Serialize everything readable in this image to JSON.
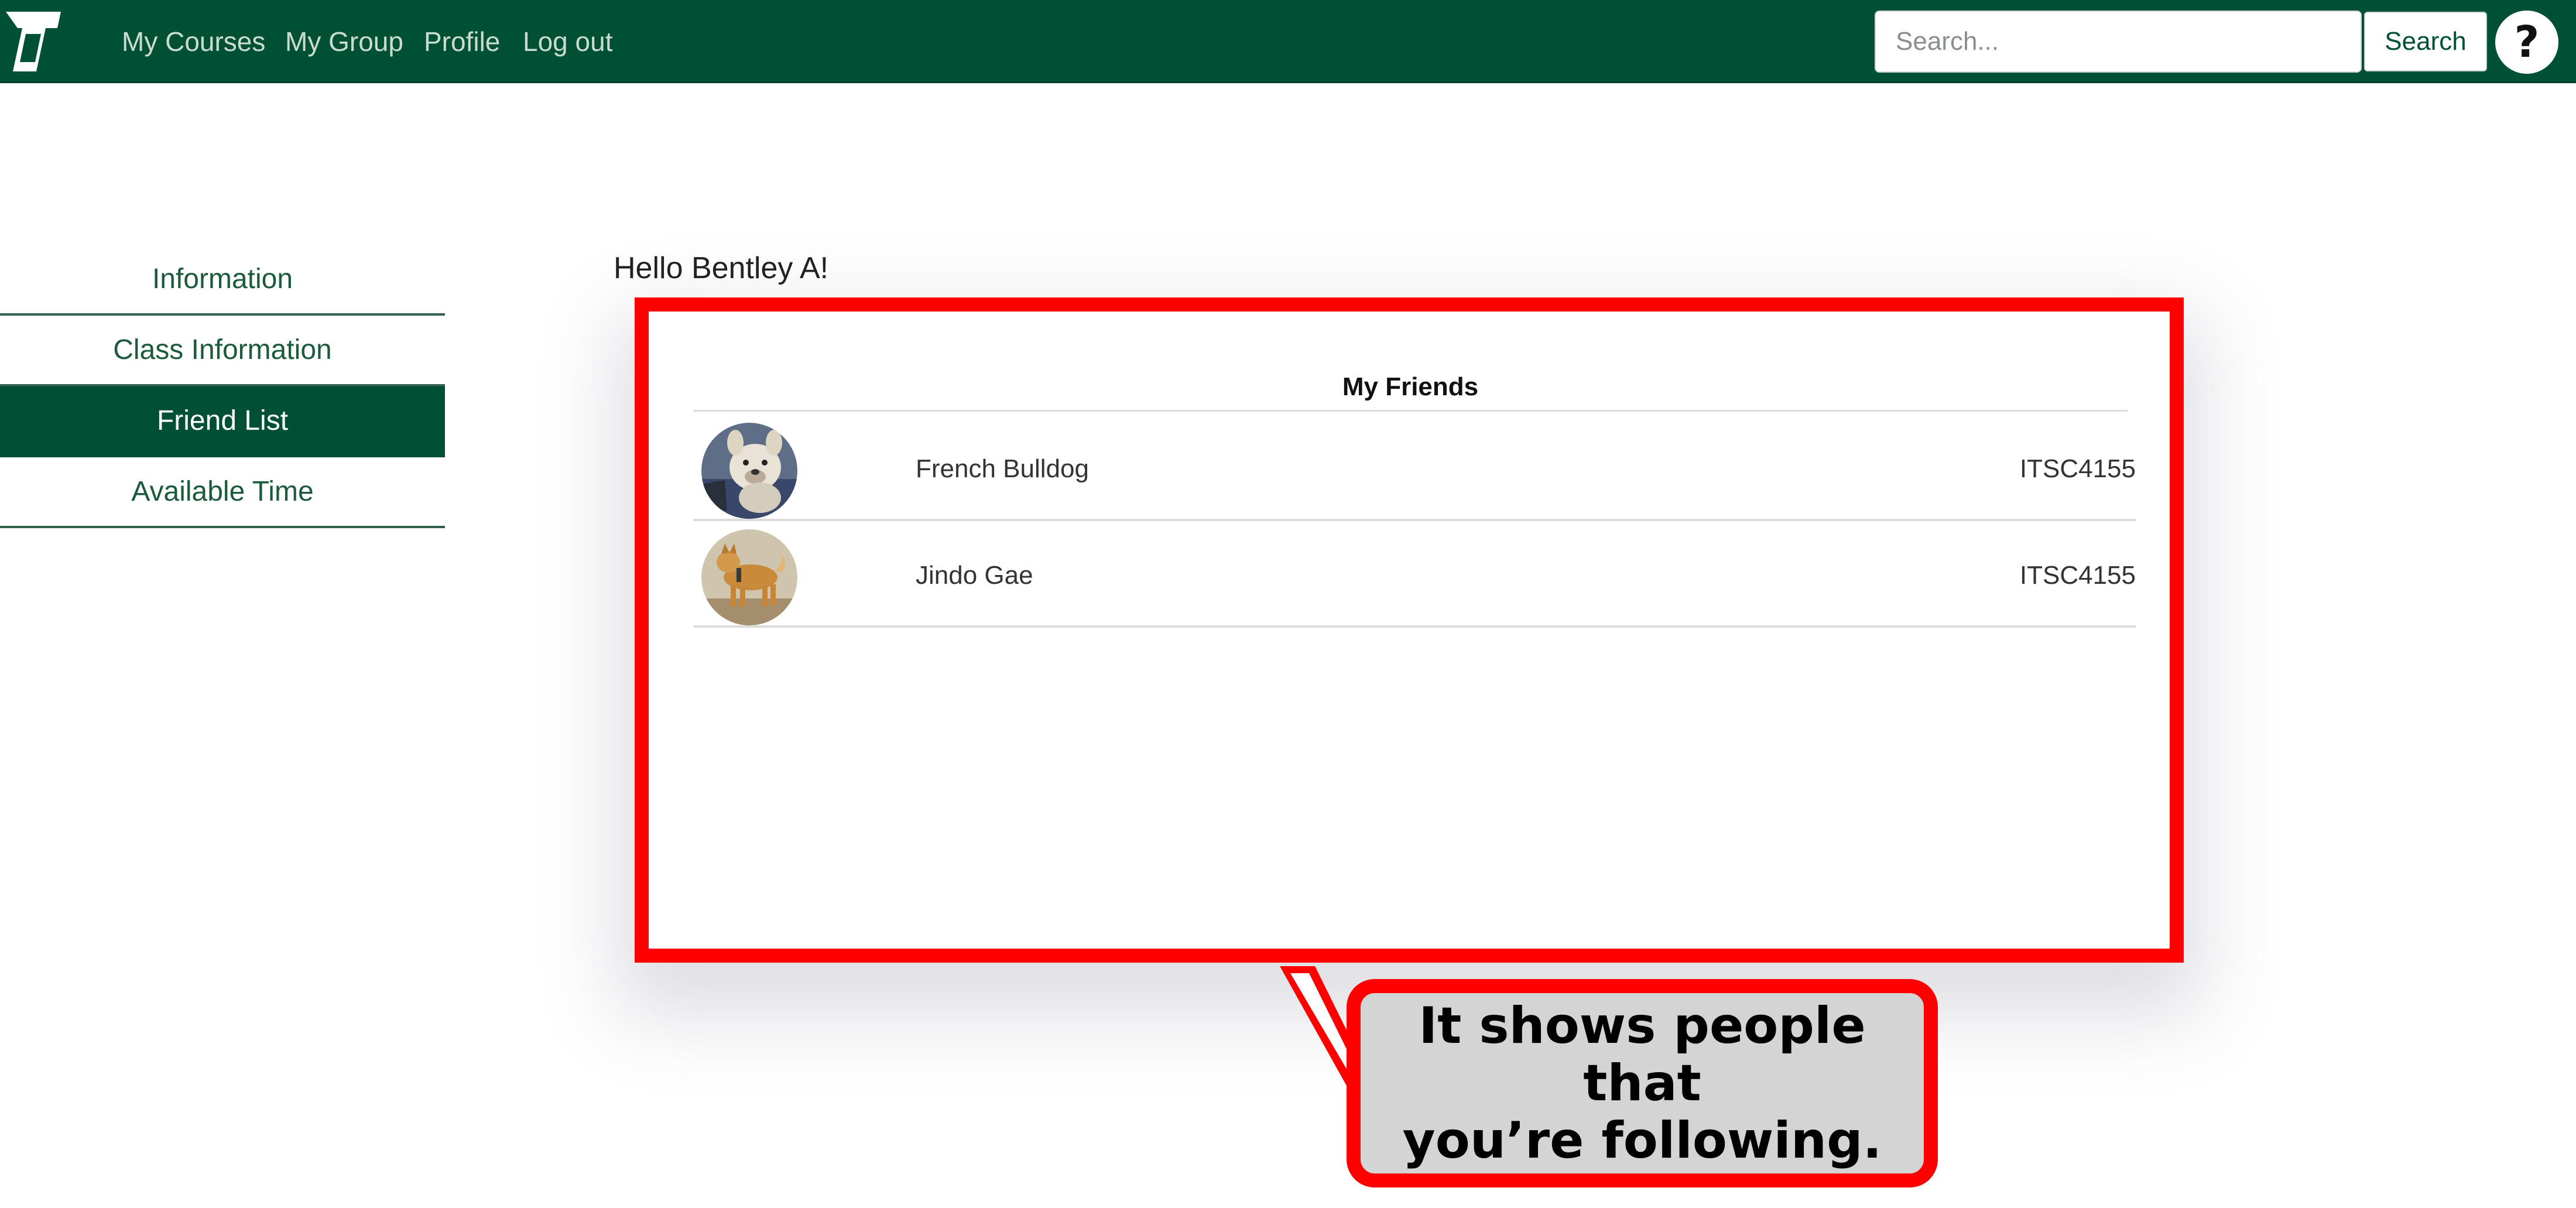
{
  "navbar": {
    "links": [
      "My Courses",
      "My Group",
      "Profile",
      "Log out"
    ],
    "search_placeholder": "Search...",
    "search_button": "Search",
    "help_label": "?",
    "bg_color": "#005035"
  },
  "sidebar": {
    "items": [
      {
        "label": "Information",
        "active": false
      },
      {
        "label": "Class Information",
        "active": false
      },
      {
        "label": "Friend List",
        "active": true
      },
      {
        "label": "Available Time",
        "active": false
      }
    ]
  },
  "main": {
    "greeting": "Hello Bentley A!",
    "friends_title": "My Friends",
    "friends": [
      {
        "name": "French Bulldog",
        "course": "ITSC4155",
        "avatar": "french-bulldog-photo"
      },
      {
        "name": "Jindo Gae",
        "course": "ITSC4155",
        "avatar": "jindo-dog-photo"
      }
    ]
  },
  "annotation": {
    "text": "It shows people that\nyou’re following.",
    "highlight_color": "#ff0000"
  }
}
